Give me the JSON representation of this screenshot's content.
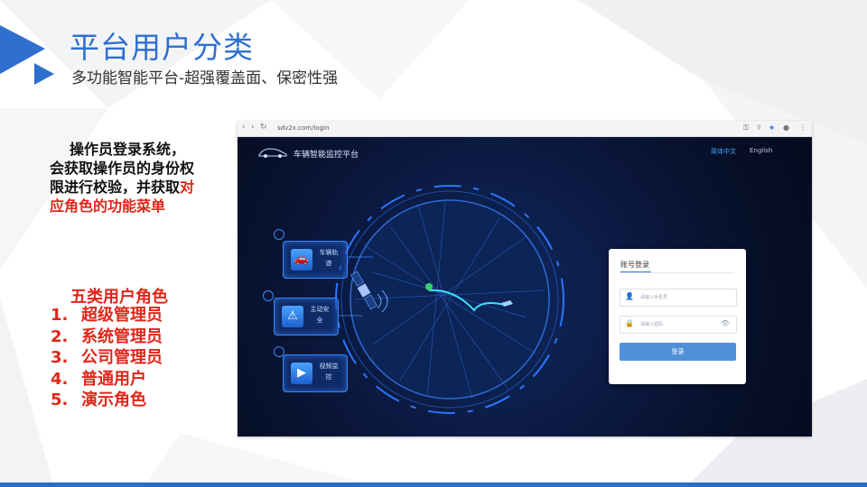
{
  "slide": {
    "title": "平台用户分类",
    "subtitle": "多功能智能平台-超强覆盖面、保密性强"
  },
  "description": {
    "black_text": "操作员登录系统，会获取操作员的身份权限进行校验，并获取",
    "red_text": "对应角色的功能菜单"
  },
  "roles": {
    "heading": "五类用户角色",
    "items": [
      {
        "num": "1.",
        "label": "超级管理员"
      },
      {
        "num": "2.",
        "label": "系统管理员"
      },
      {
        "num": "3.",
        "label": "公司管理员"
      },
      {
        "num": "4.",
        "label": "普通用户"
      },
      {
        "num": "5.",
        "label": "演示角色"
      }
    ]
  },
  "browser": {
    "url": "sdv2x.com/login",
    "app_title": "车辆智能监控平台",
    "lang_zh": "简体中文",
    "lang_en": "English",
    "features": [
      {
        "label": "车辆轨迹",
        "icon": "car-icon"
      },
      {
        "label": "主动安全",
        "icon": "alarm-icon"
      },
      {
        "label": "视频监控",
        "icon": "video-icon"
      }
    ],
    "login": {
      "tab": "账号登录",
      "username_placeholder": "请输入手机号",
      "password_placeholder": "请输入密码",
      "submit": "登录"
    }
  },
  "colors": {
    "title_blue": "#2f6fd0",
    "accent_red": "#e0261a",
    "bottom_bar": "#2b6cc4",
    "login_button": "#4f90d9"
  }
}
